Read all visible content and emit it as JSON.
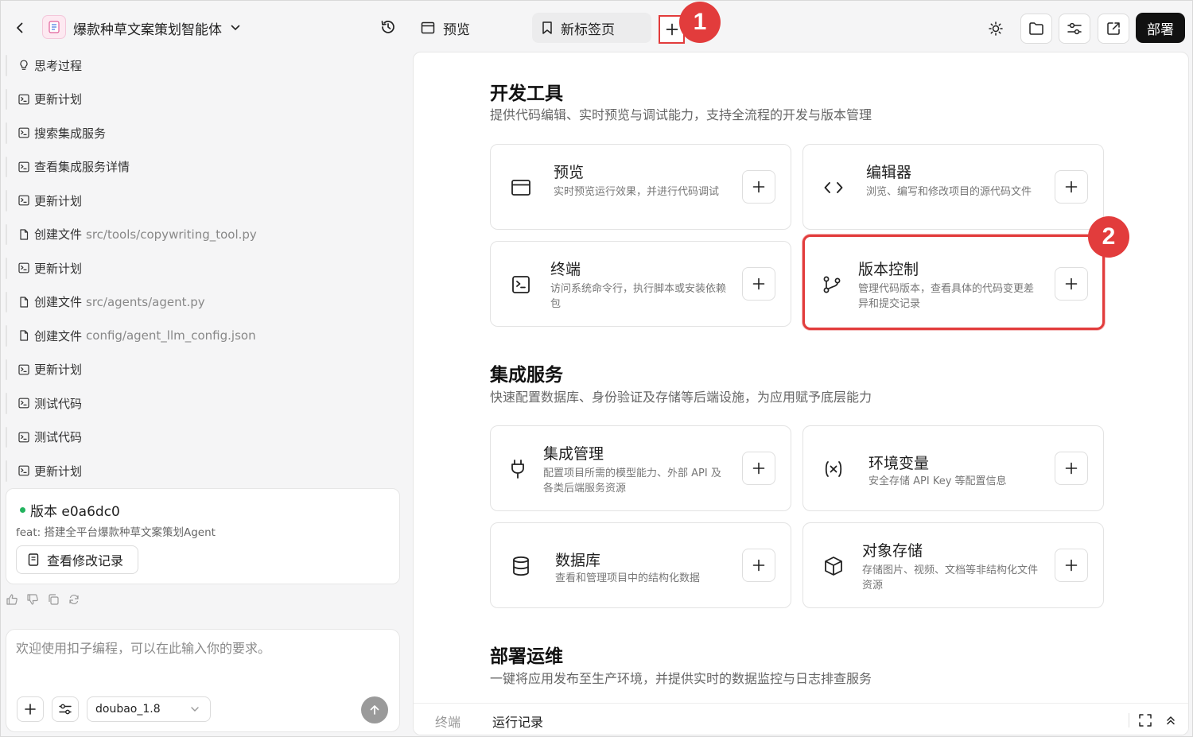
{
  "app": {
    "title": "爆款种草文案策划智能体"
  },
  "steps": [
    {
      "icon": "lightbulb-icon",
      "label": "思考过程",
      "path": ""
    },
    {
      "icon": "terminal-icon",
      "label": "更新计划",
      "path": ""
    },
    {
      "icon": "terminal-icon",
      "label": "搜索集成服务",
      "path": ""
    },
    {
      "icon": "terminal-icon",
      "label": "查看集成服务详情",
      "path": ""
    },
    {
      "icon": "terminal-icon",
      "label": "更新计划",
      "path": ""
    },
    {
      "icon": "file-icon",
      "label": "创建文件",
      "path": "src/tools/copywriting_tool.py"
    },
    {
      "icon": "terminal-icon",
      "label": "更新计划",
      "path": ""
    },
    {
      "icon": "file-icon",
      "label": "创建文件",
      "path": "src/agents/agent.py"
    },
    {
      "icon": "file-icon",
      "label": "创建文件",
      "path": "config/agent_llm_config.json"
    },
    {
      "icon": "terminal-icon",
      "label": "更新计划",
      "path": ""
    },
    {
      "icon": "terminal-icon",
      "label": "测试代码",
      "path": ""
    },
    {
      "icon": "terminal-icon",
      "label": "测试代码",
      "path": ""
    },
    {
      "icon": "terminal-icon",
      "label": "更新计划",
      "path": ""
    }
  ],
  "version": {
    "title": "版本 e0a6dc0",
    "message": "feat: 搭建全平台爆款种草文案策划Agent",
    "button_label": "查看修改记录",
    "status_color": "#22b35e"
  },
  "chat": {
    "placeholder": "欢迎使用扣子编程，可以在此输入你的要求。",
    "model": "doubao_1.8"
  },
  "topbar": {
    "tab_preview": "预览",
    "tab_new": "新标签页",
    "deploy_label": "部署",
    "badge1": "1",
    "badge2": "2"
  },
  "sections": [
    {
      "title": "开发工具",
      "desc": "提供代码编辑、实时预览与调试能力，支持全流程的开发与版本管理"
    },
    {
      "title": "集成服务",
      "desc": "快速配置数据库、身份验证及存储等后端设施，为应用赋予底层能力"
    },
    {
      "title": "部署运维",
      "desc": "一键将应用发布至生产环境，并提供实时的数据监控与日志排查服务"
    }
  ],
  "cards": {
    "preview": {
      "title": "预览",
      "desc": "实时预览运行效果，并进行代码调试"
    },
    "editor": {
      "title": "编辑器",
      "desc": "浏览、编写和修改项目的源代码文件"
    },
    "terminal": {
      "title": "终端",
      "desc": "访问系统命令行，执行脚本或安装依赖包"
    },
    "vcs": {
      "title": "版本控制",
      "desc": "管理代码版本，查看具体的代码变更差异和提交记录"
    },
    "integration": {
      "title": "集成管理",
      "desc": "配置项目所需的模型能力、外部 API 及各类后端服务资源"
    },
    "env": {
      "title": "环境变量",
      "desc": "安全存储 API Key 等配置信息"
    },
    "database": {
      "title": "数据库",
      "desc": "查看和管理项目中的结构化数据"
    },
    "storage": {
      "title": "对象存储",
      "desc": "存储图片、视频、文档等非结构化文件资源"
    }
  },
  "bottom": {
    "tab_terminal": "终端",
    "tab_logs": "运行记录"
  },
  "colors": {
    "highlight": "#e23c3c",
    "accent_dark": "#111111"
  }
}
